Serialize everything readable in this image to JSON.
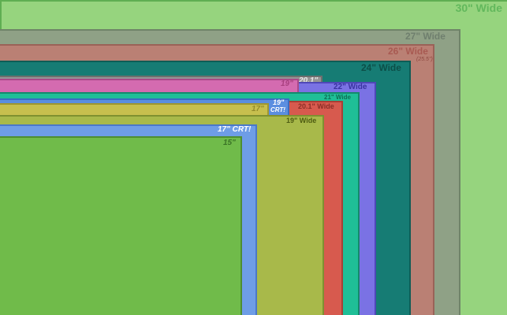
{
  "screens": [
    {
      "key": "w30",
      "label": "30\" Wide",
      "color": "#96d47e",
      "text_color": "#62b85c"
    },
    {
      "key": "w27",
      "label": "27\" Wide",
      "color": "#8fa186",
      "text_color": "#7b8d7b"
    },
    {
      "key": "w26",
      "label": "26\" Wide",
      "sublabel": "(25.5\")",
      "color": "#ba8074",
      "text_color": "#b0655d"
    },
    {
      "key": "w24",
      "label": "24\" Wide",
      "color": "#167c74",
      "text_color": "#167c74"
    },
    {
      "key": "s201",
      "label": "20.1\"",
      "color": "#959595",
      "text_color": "#8a8a8a"
    },
    {
      "key": "w22",
      "label": "22\" Wide",
      "color": "#7a72e4",
      "text_color": "#5b52c8"
    },
    {
      "key": "s19",
      "label": "19\"",
      "color": "#d46bb0",
      "text_color": "#c0569a"
    },
    {
      "key": "w21",
      "label": "21\" Wide",
      "color": "#1fbf97",
      "text_color": "#1a9f7f"
    },
    {
      "key": "crt19",
      "label": "19\"",
      "sublabel": "CRT!",
      "color": "#5b8ee0",
      "text_color": "#ffffff"
    },
    {
      "key": "w201",
      "label": "20.1\" Wide",
      "color": "#d75a4e",
      "text_color": "#b8433a"
    },
    {
      "key": "s17",
      "label": "17\"",
      "color": "#c7bf4e",
      "text_color": "#a89f38"
    },
    {
      "key": "w19",
      "label": "19\" Wide",
      "color": "#a8b94a",
      "text_color": "#6a7a20"
    },
    {
      "key": "crt17",
      "label": "17\" CRT!",
      "color": "#6e9de6",
      "text_color": "#ffffff"
    },
    {
      "key": "s15",
      "label": "15\"",
      "color": "#70bb4a",
      "text_color": "#3e7c2a"
    }
  ]
}
